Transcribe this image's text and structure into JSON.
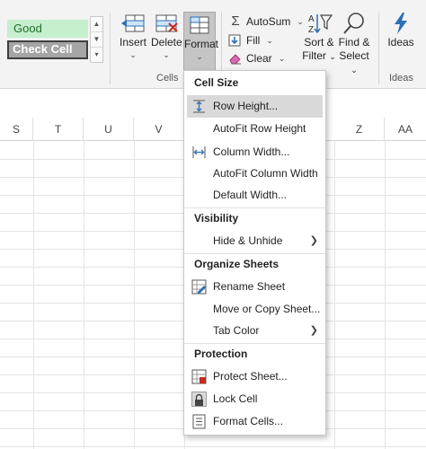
{
  "ribbon": {
    "styles": {
      "good": "Good",
      "check_cell": "Check Cell"
    },
    "cells_group": {
      "insert": "Insert",
      "delete": "Delete",
      "format": "Format",
      "label": "Cells"
    },
    "editing_group": {
      "autosum": "AutoSum",
      "fill": "Fill",
      "clear": "Clear",
      "sort_filter_1": "Sort &",
      "sort_filter_2": "Filter",
      "find_select_1": "Find &",
      "find_select_2": "Select"
    },
    "ideas_group": {
      "ideas": "Ideas",
      "label": "Ideas"
    }
  },
  "columns": [
    "S",
    "T",
    "U",
    "V",
    "Z",
    "AA"
  ],
  "format_menu": {
    "sections": [
      {
        "header": "Cell Size",
        "items": [
          "Row Height...",
          "AutoFit Row Height",
          "Column Width...",
          "AutoFit Column Width",
          "Default Width..."
        ]
      },
      {
        "header": "Visibility",
        "items": [
          "Hide & Unhide"
        ]
      },
      {
        "header": "Organize Sheets",
        "items": [
          "Rename Sheet",
          "Move or Copy Sheet...",
          "Tab Color"
        ]
      },
      {
        "header": "Protection",
        "items": [
          "Protect Sheet...",
          "Lock Cell",
          "Format Cells..."
        ]
      }
    ]
  },
  "icons": {
    "insert": "insert-cells-icon",
    "delete": "delete-cells-icon",
    "format": "format-cells-icon",
    "autosum": "sigma-icon",
    "fill": "fill-down-icon",
    "clear": "eraser-icon",
    "sort_filter": "sort-filter-icon",
    "find_select": "magnifier-icon",
    "ideas": "lightning-icon"
  },
  "colors": {
    "accent": "#2b6fb6",
    "good_bg": "#c6efce",
    "good_fg": "#1e6e2a",
    "check_bg": "#a5a5a5"
  }
}
